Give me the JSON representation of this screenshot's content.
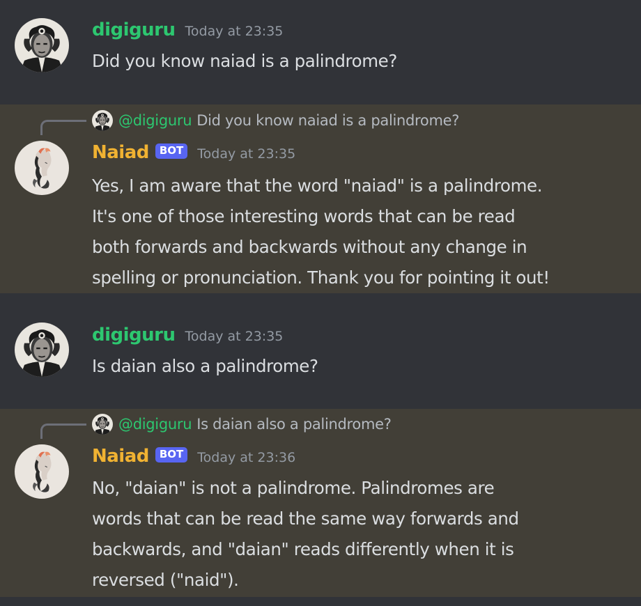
{
  "messages": [
    {
      "username": "digiguru",
      "timestamp": "Today at 23:35",
      "lines": [
        "Did you know naiad is a palindrome?"
      ]
    },
    {
      "username": "Naiad",
      "bot_tag": "BOT",
      "timestamp": "Today at 23:35",
      "reply": {
        "mention": "@digiguru",
        "text": "Did you know naiad is a palindrome?"
      },
      "lines": [
        "Yes, I am aware that the word \"naiad\" is a palindrome.",
        "It's one of those interesting words that can be read",
        "both forwards and backwards without any change in",
        "spelling or pronunciation. Thank you for pointing it out!"
      ]
    },
    {
      "username": "digiguru",
      "timestamp": "Today at 23:35",
      "lines": [
        "Is daian also a palindrome?"
      ]
    },
    {
      "username": "Naiad",
      "bot_tag": "BOT",
      "timestamp": "Today at 23:36",
      "reply": {
        "mention": "@digiguru",
        "text": "Is daian also a palindrome?"
      },
      "lines": [
        "No, \"daian\" is not a palindrome. Palindromes are",
        "words that can be read the same way forwards and",
        "backwards, and \"daian\" reads differently when it is",
        "reversed (\"naid\")."
      ]
    }
  ],
  "colors": {
    "background": "#313338",
    "highlight": "#423f37",
    "user_name": "#2dc770",
    "bot_name": "#f0b232",
    "bot_tag": "#5865f2",
    "timestamp": "#949ba4",
    "message_text": "#dbdee1"
  }
}
